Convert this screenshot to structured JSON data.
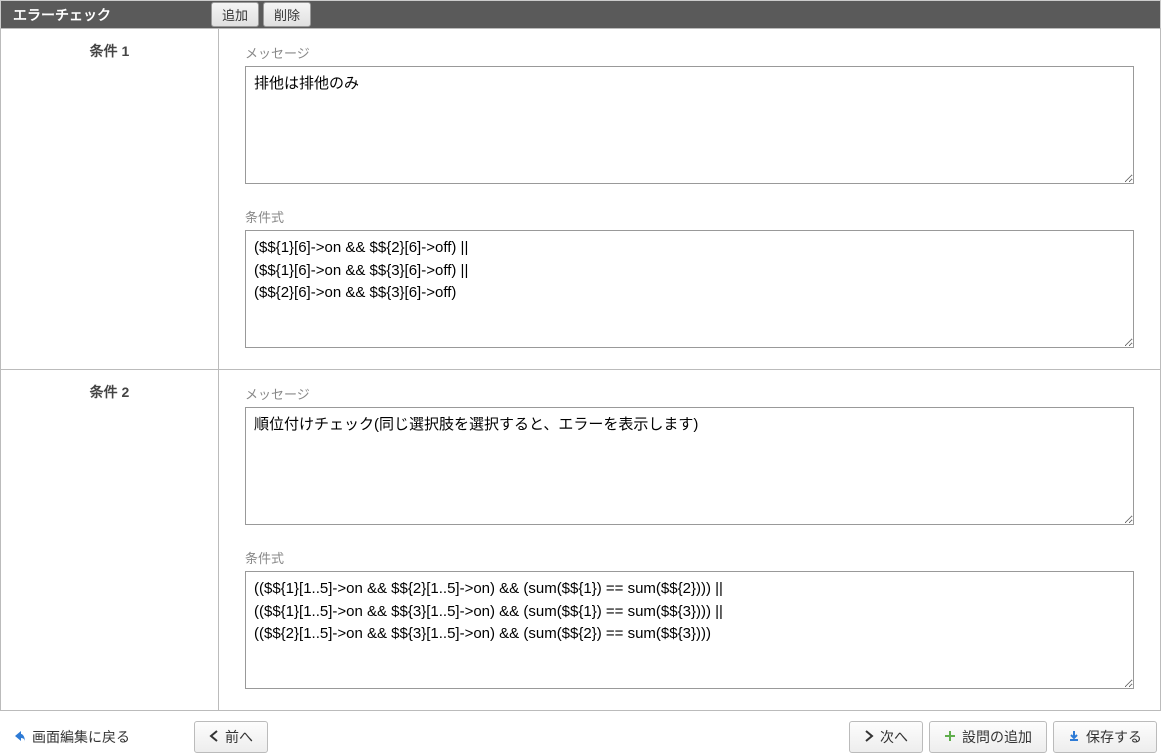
{
  "header": {
    "title": "エラーチェック",
    "add_label": "追加",
    "delete_label": "削除"
  },
  "conditions": [
    {
      "label": "条件 1",
      "message_label": "メッセージ",
      "message_value": "排他は排他のみ",
      "expression_label": "条件式",
      "expression_value": "($${1}[6]->on && $${2}[6]->off) ||\n($${1}[6]->on && $${3}[6]->off) ||\n($${2}[6]->on && $${3}[6]->off)"
    },
    {
      "label": "条件 2",
      "message_label": "メッセージ",
      "message_value": "順位付けチェック(同じ選択肢を選択すると、エラーを表示します)",
      "expression_label": "条件式",
      "expression_value": "(($${1}[1..5]->on && $${2}[1..5]->on) && (sum($${1}) == sum($${2}))) ||\n(($${1}[1..5]->on && $${3}[1..5]->on) && (sum($${1}) == sum($${3}))) ||\n(($${2}[1..5]->on && $${3}[1..5]->on) && (sum($${2}) == sum($${3})))"
    }
  ],
  "footer": {
    "back_to_edit": "画面編集に戻る",
    "prev": "前へ",
    "next": "次へ",
    "add_question": "設問の追加",
    "save": "保存する"
  }
}
